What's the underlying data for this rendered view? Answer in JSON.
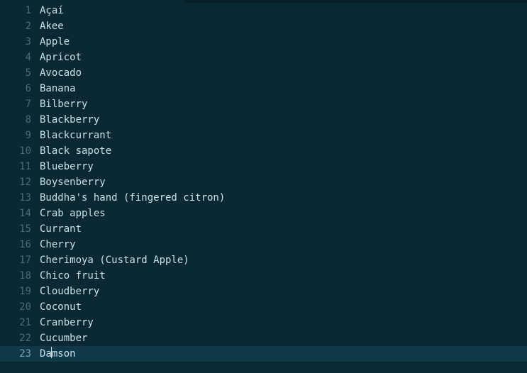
{
  "editor": {
    "current_line_index": 22,
    "lines": [
      {
        "num": "1",
        "text": "Açaí"
      },
      {
        "num": "2",
        "text": "Akee"
      },
      {
        "num": "3",
        "text": "Apple"
      },
      {
        "num": "4",
        "text": "Apricot"
      },
      {
        "num": "5",
        "text": "Avocado"
      },
      {
        "num": "6",
        "text": "Banana"
      },
      {
        "num": "7",
        "text": "Bilberry"
      },
      {
        "num": "8",
        "text": "Blackberry"
      },
      {
        "num": "9",
        "text": "Blackcurrant"
      },
      {
        "num": "10",
        "text": "Black sapote"
      },
      {
        "num": "11",
        "text": "Blueberry"
      },
      {
        "num": "12",
        "text": "Boysenberry"
      },
      {
        "num": "13",
        "text": "Buddha's hand (fingered citron)"
      },
      {
        "num": "14",
        "text": "Crab apples"
      },
      {
        "num": "15",
        "text": "Currant"
      },
      {
        "num": "16",
        "text": "Cherry"
      },
      {
        "num": "17",
        "text": "Cherimoya (Custard Apple)"
      },
      {
        "num": "18",
        "text": "Chico fruit"
      },
      {
        "num": "19",
        "text": "Cloudberry"
      },
      {
        "num": "20",
        "text": "Coconut"
      },
      {
        "num": "21",
        "text": "Cranberry"
      },
      {
        "num": "22",
        "text": "Cucumber"
      },
      {
        "num": "23",
        "text": "Damson"
      }
    ]
  }
}
